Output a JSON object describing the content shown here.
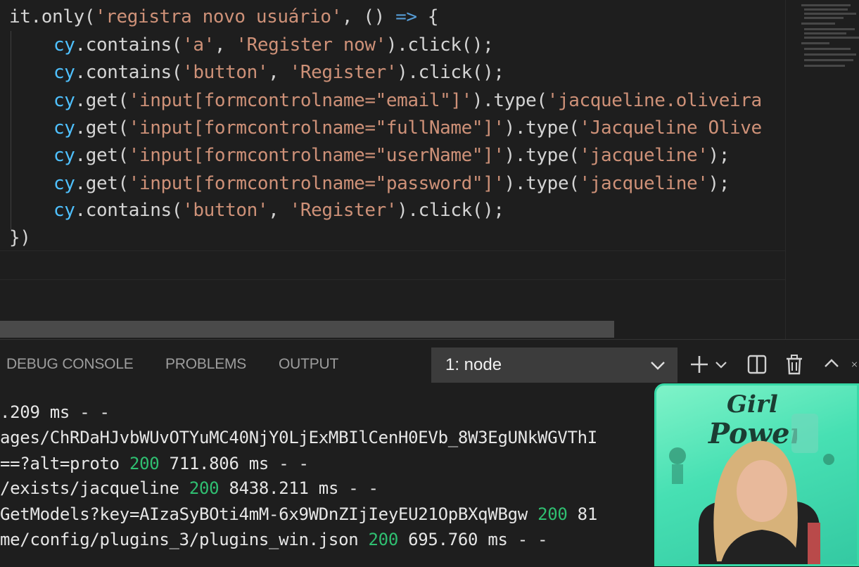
{
  "editor": {
    "line1": {
      "p1": "it",
      "p2": ".only(",
      "p3": "'registra novo usuário'",
      "p4": ", () ",
      "p5": "=>",
      "p6": " {"
    },
    "lines": [
      {
        "obj": "cy",
        "call": ".contains(",
        "a1": "'a'",
        "sep": ", ",
        "a2": "'Register now'",
        "tail": ").click();"
      },
      {
        "obj": "cy",
        "call": ".contains(",
        "a1": "'button'",
        "sep": ", ",
        "a2": "'Register'",
        "tail": ").click();"
      },
      {
        "obj": "cy",
        "call": ".get(",
        "a1": "'input[formcontrolname=\"email\"]'",
        "sep": ").type(",
        "a2": "'jacqueline.oliveira",
        "tail": ""
      },
      {
        "obj": "cy",
        "call": ".get(",
        "a1": "'input[formcontrolname=\"fullName\"]'",
        "sep": ").type(",
        "a2": "'Jacqueline Olive",
        "tail": ""
      },
      {
        "obj": "cy",
        "call": ".get(",
        "a1": "'input[formcontrolname=\"userName\"]'",
        "sep": ").type(",
        "a2": "'jacqueline'",
        "tail": ");"
      },
      {
        "obj": "cy",
        "call": ".get(",
        "a1": "'input[formcontrolname=\"password\"]'",
        "sep": ").type(",
        "a2": "'jacqueline'",
        "tail": ");"
      },
      {
        "obj": "cy",
        "call": ".contains(",
        "a1": "'button'",
        "sep": ", ",
        "a2": "'Register'",
        "tail": ").click();"
      }
    ],
    "closing": "})"
  },
  "panel": {
    "tabs": [
      "DEBUG CONSOLE",
      "PROBLEMS",
      "OUTPUT"
    ],
    "terminal_select": "1: node",
    "terminal_lines": [
      {
        "pre": ".209 ms - -",
        "status": "",
        "post": ""
      },
      {
        "pre": "ages/ChRDaHJvbWUvOTYuMC40NjY0LjExMBIlCenH0EVb_8W3EgUNkWGVThI",
        "status": "",
        "post": ""
      },
      {
        "pre": "==?alt=proto ",
        "status": "200",
        "post": " 711.806 ms - -"
      },
      {
        "pre": "/exists/jacqueline ",
        "status": "200",
        "post": " 8438.211 ms - -"
      },
      {
        "pre": "GetModels?key=AIzaSyBOti4mM-6x9WDnZIjIeyEU21OpBXqWBgw ",
        "status": "200",
        "post": " 81"
      },
      {
        "pre": "me/config/plugins_3/plugins_win.json ",
        "status": "200",
        "post": " 695.760 ms - -"
      }
    ]
  },
  "webcam": {
    "poster_text_1": "Girl",
    "poster_text_2": "Power"
  },
  "colors": {
    "status_ok": "#2fbf71",
    "string": "#ce9178",
    "object": "#4fc1ff",
    "keyword": "#569cd6"
  }
}
